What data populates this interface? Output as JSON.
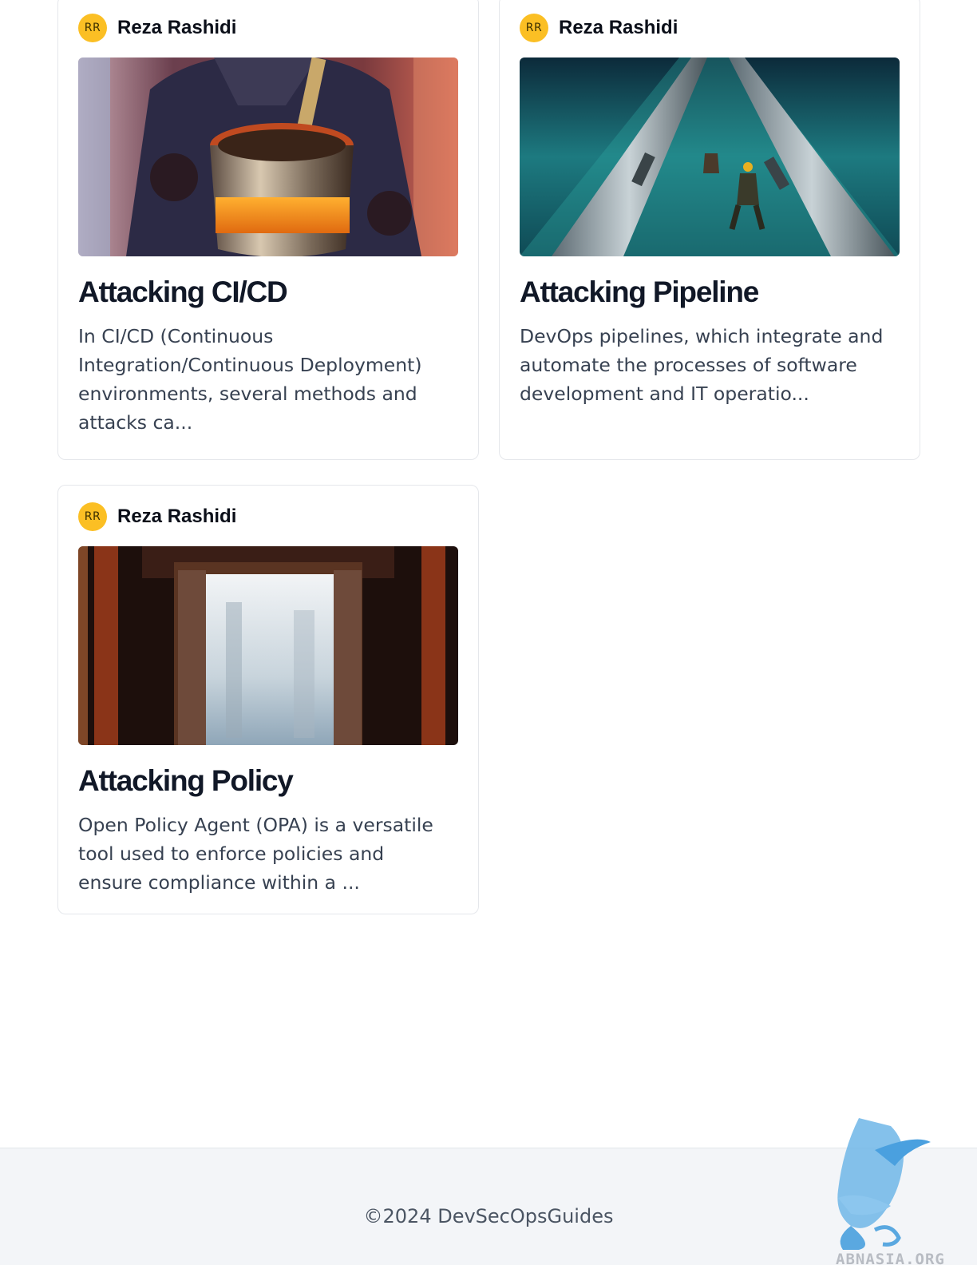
{
  "posts": [
    {
      "author": {
        "initials": "RR",
        "name": "Reza Rashidi"
      },
      "image_alt": "Attacking CI/CD illustration",
      "title": "Attacking CI/CD",
      "excerpt": "In CI/CD (Continuous Integration/Continuous Deployment) environments, several methods and attacks ca..."
    },
    {
      "author": {
        "initials": "RR",
        "name": "Reza Rashidi"
      },
      "image_alt": "Attacking Pipeline illustration",
      "title": "Attacking Pipeline",
      "excerpt": "DevOps pipelines, which integrate and automate the processes of software development and IT operatio..."
    },
    {
      "author": {
        "initials": "RR",
        "name": "Reza Rashidi"
      },
      "image_alt": "Attacking Policy illustration",
      "title": "Attacking Policy",
      "excerpt": "Open Policy Agent (OPA) is a versatile tool used to enforce policies and ensure compliance within a ..."
    }
  ],
  "footer": {
    "copyright": "©2024 DevSecOpsGuides"
  },
  "watermark": {
    "text": "ABNASIA.ORG"
  },
  "colors": {
    "avatar_bg": "#fbbf24",
    "title": "#111827",
    "excerpt": "#374151",
    "footer_bg": "#f3f5f8",
    "card_border": "#e5e7eb"
  }
}
